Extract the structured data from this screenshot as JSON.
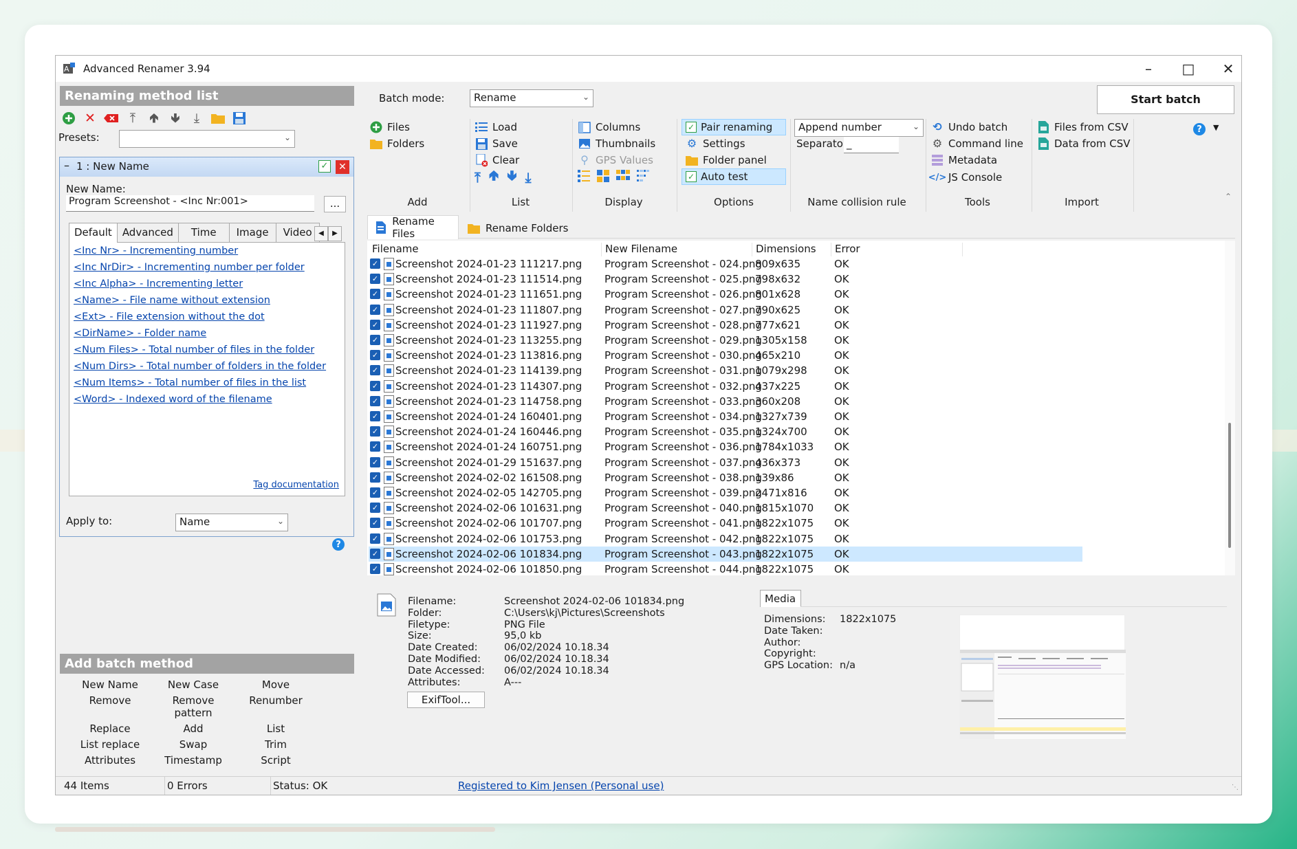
{
  "window": {
    "title": "Advanced Renamer 3.94"
  },
  "left": {
    "method_list_header": "Renaming method list",
    "presets_label": "Presets:",
    "method_title": "1 : New Name",
    "new_name_label": "New Name:",
    "new_name_value": "Program Screenshot - <Inc Nr:001>",
    "browse_btn": "...",
    "tabs": [
      "Default",
      "Advanced",
      "Time",
      "Image",
      "Video"
    ],
    "tags": [
      "<Inc Nr> - Incrementing number",
      "<Inc NrDir> - Incrementing number per folder",
      "<Inc Alpha> - Incrementing letter",
      "<Name> - File name without extension",
      "<Ext> - File extension without the dot",
      "<DirName> - Folder name",
      "<Num Files> - Total number of files in the folder",
      "<Num Dirs> - Total number of folders in the folder",
      "<Num Items> - Total number of files in the list",
      "<Word> - Indexed word of the filename"
    ],
    "tag_doc": "Tag documentation",
    "apply_to_label": "Apply to:",
    "apply_to_value": "Name",
    "add_batch_header": "Add batch method",
    "batch_methods": [
      "New Name",
      "New Case",
      "Move",
      "Remove",
      "Remove pattern",
      "Renumber",
      "Replace",
      "Add",
      "List",
      "List replace",
      "Swap",
      "Trim",
      "Attributes",
      "Timestamp",
      "Script"
    ]
  },
  "ribbon": {
    "batch_mode_label": "Batch mode:",
    "batch_mode_value": "Rename",
    "start_batch": "Start batch",
    "add": {
      "files": "Files",
      "folders": "Folders",
      "group": "Add"
    },
    "list": {
      "load": "Load",
      "save": "Save",
      "clear": "Clear",
      "group": "List"
    },
    "display": {
      "columns": "Columns",
      "thumbnails": "Thumbnails",
      "gps": "GPS Values",
      "group": "Display"
    },
    "options": {
      "pair": "Pair renaming",
      "settings": "Settings",
      "folder_panel": "Folder panel",
      "auto_test": "Auto test",
      "group": "Options"
    },
    "collision": {
      "value": "Append number",
      "separator_label": "Separator:",
      "separator_value": "_",
      "group": "Name collision rule"
    },
    "tools": {
      "undo": "Undo batch",
      "cmd": "Command line",
      "meta": "Metadata",
      "js": "JS Console",
      "group": "Tools"
    },
    "import": {
      "files_csv": "Files from CSV",
      "data_csv": "Data from CSV",
      "group": "Import"
    }
  },
  "list_tabs": {
    "files": "Rename Files",
    "folders": "Rename Folders"
  },
  "columns": [
    "Filename",
    "New Filename",
    "Dimensions",
    "Error"
  ],
  "rows": [
    [
      "Screenshot 2024-01-23 111217.png",
      "Program Screenshot - 024.png",
      "809x635",
      "OK"
    ],
    [
      "Screenshot 2024-01-23 111514.png",
      "Program Screenshot - 025.png",
      "798x632",
      "OK"
    ],
    [
      "Screenshot 2024-01-23 111651.png",
      "Program Screenshot - 026.png",
      "801x628",
      "OK"
    ],
    [
      "Screenshot 2024-01-23 111807.png",
      "Program Screenshot - 027.png",
      "790x625",
      "OK"
    ],
    [
      "Screenshot 2024-01-23 111927.png",
      "Program Screenshot - 028.png",
      "777x621",
      "OK"
    ],
    [
      "Screenshot 2024-01-23 113255.png",
      "Program Screenshot - 029.png",
      "1305x158",
      "OK"
    ],
    [
      "Screenshot 2024-01-23 113816.png",
      "Program Screenshot - 030.png",
      "465x210",
      "OK"
    ],
    [
      "Screenshot 2024-01-23 114139.png",
      "Program Screenshot - 031.png",
      "1079x298",
      "OK"
    ],
    [
      "Screenshot 2024-01-23 114307.png",
      "Program Screenshot - 032.png",
      "437x225",
      "OK"
    ],
    [
      "Screenshot 2024-01-23 114758.png",
      "Program Screenshot - 033.png",
      "360x208",
      "OK"
    ],
    [
      "Screenshot 2024-01-24 160401.png",
      "Program Screenshot - 034.png",
      "1327x739",
      "OK"
    ],
    [
      "Screenshot 2024-01-24 160446.png",
      "Program Screenshot - 035.png",
      "1324x700",
      "OK"
    ],
    [
      "Screenshot 2024-01-24 160751.png",
      "Program Screenshot - 036.png",
      "1784x1033",
      "OK"
    ],
    [
      "Screenshot 2024-01-29 151637.png",
      "Program Screenshot - 037.png",
      "436x373",
      "OK"
    ],
    [
      "Screenshot 2024-02-02 161508.png",
      "Program Screenshot - 038.png",
      "139x86",
      "OK"
    ],
    [
      "Screenshot 2024-02-05 142705.png",
      "Program Screenshot - 039.png",
      "2471x816",
      "OK"
    ],
    [
      "Screenshot 2024-02-06 101631.png",
      "Program Screenshot - 040.png",
      "1815x1070",
      "OK"
    ],
    [
      "Screenshot 2024-02-06 101707.png",
      "Program Screenshot - 041.png",
      "1822x1075",
      "OK"
    ],
    [
      "Screenshot 2024-02-06 101753.png",
      "Program Screenshot - 042.png",
      "1822x1075",
      "OK"
    ],
    [
      "Screenshot 2024-02-06 101834.png",
      "Program Screenshot - 043.png",
      "1822x1075",
      "OK"
    ],
    [
      "Screenshot 2024-02-06 101850.png",
      "Program Screenshot - 044.png",
      "1822x1075",
      "OK"
    ]
  ],
  "details": {
    "labels": [
      "Filename:",
      "Folder:",
      "Filetype:",
      "Size:",
      "Date Created:",
      "Date Modified:",
      "Date Accessed:",
      "Attributes:"
    ],
    "values": [
      "Screenshot 2024-02-06 101834.png",
      "C:\\Users\\kj\\Pictures\\Screenshots",
      "PNG File",
      "95,0 kb",
      "06/02/2024 10.18.34",
      "06/02/2024 10.18.34",
      "06/02/2024 10.18.34",
      "A---"
    ],
    "exiftool": "ExifTool...",
    "media_tab": "Media",
    "media_labels": [
      "Dimensions:",
      "Date Taken:",
      "Author:",
      "Copyright:",
      "GPS Location:"
    ],
    "media_values": [
      "1822x1075",
      "",
      "",
      "",
      "n/a"
    ]
  },
  "status": {
    "items": "44 Items",
    "errors": "0 Errors",
    "status": "Status: OK",
    "registered": "Registered to Kim Jensen (Personal use)"
  }
}
